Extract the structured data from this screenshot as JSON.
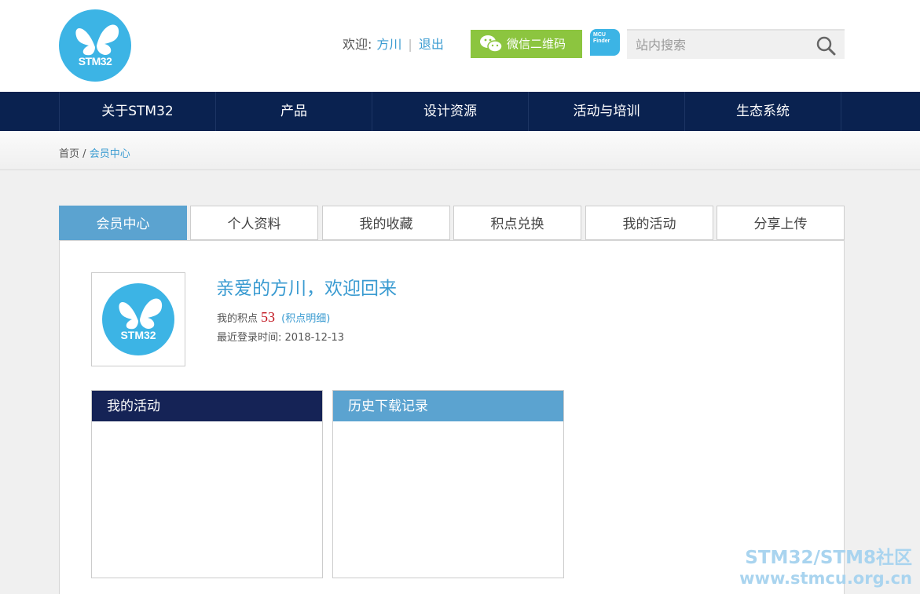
{
  "header": {
    "logo_text": "STM32",
    "welcome_label": "欢迎:",
    "username": "方川",
    "separator": "|",
    "logout": "退出",
    "wechat_button": "微信二维码",
    "mcu_finder_line1": "MCU",
    "mcu_finder_line2": "Finder",
    "search_placeholder": "站内搜索"
  },
  "nav": {
    "items": [
      "关于STM32",
      "产品",
      "设计资源",
      "活动与培训",
      "生态系统"
    ]
  },
  "breadcrumb": {
    "home": "首页",
    "separator": "/",
    "current": "会员中心"
  },
  "tabs": [
    "会员中心",
    "个人资料",
    "我的收藏",
    "积点兑换",
    "我的活动",
    "分享上传"
  ],
  "active_tab": "会员中心",
  "profile": {
    "avatar_text": "STM32",
    "greeting": "亲爱的方川，欢迎回来",
    "points_label": "我的积点",
    "points_value": "53",
    "points_detail": "(积点明细)",
    "last_login_label": "最近登录时间:",
    "last_login_value": "2018-12-13"
  },
  "boxes": {
    "activities_title": "我的活动",
    "downloads_title": "历史下载记录"
  },
  "watermark": {
    "line1": "STM32/STM8社区",
    "line2": "www.stmcu.org.cn"
  },
  "colors": {
    "nav_bg": "#0a2250",
    "accent": "#3a9bd1",
    "tab_active": "#5ba3d0",
    "wechat": "#8cc53f",
    "points": "#c0101a"
  }
}
